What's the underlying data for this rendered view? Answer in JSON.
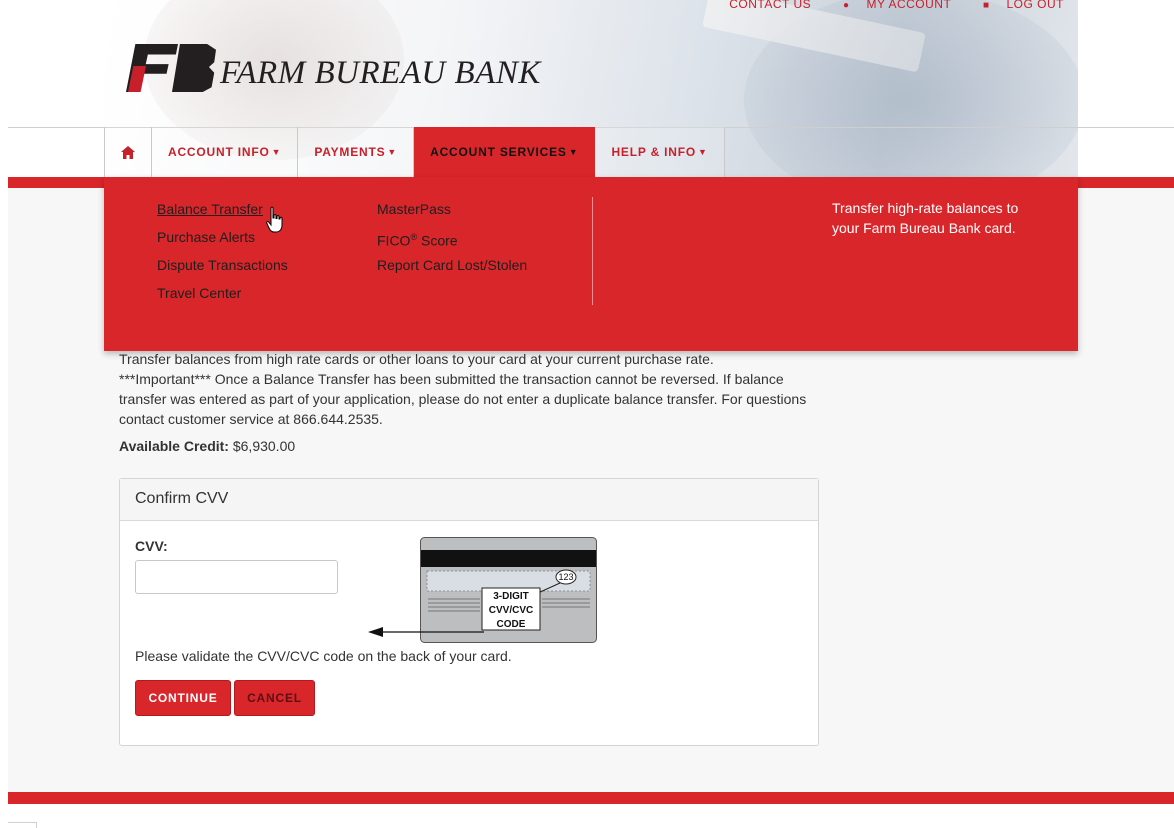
{
  "top_links": {
    "contact": "CONTACT US",
    "my_account": "MY ACCOUNT",
    "log_out": "LOG OUT"
  },
  "brand": {
    "name": "FARM BUREAU",
    "name_suffix": "BANK",
    "primary_color": "#d9262b"
  },
  "nav": {
    "items": [
      {
        "label": "ACCOUNT INFO"
      },
      {
        "label": "PAYMENTS"
      },
      {
        "label": "ACCOUNT SERVICES"
      },
      {
        "label": "HELP & INFO"
      }
    ],
    "active": "ACCOUNT SERVICES"
  },
  "dropdown": {
    "col1": [
      "Balance Transfer",
      "Purchase Alerts",
      "Dispute Transactions",
      "Travel Center"
    ],
    "col2": {
      "masterpass": "MasterPass",
      "fico_pre": "FICO",
      "fico_sup": "®",
      "fico_post": " Score",
      "lost_stolen": "Report Card Lost/Stolen"
    },
    "description": "Transfer high-rate balances to your Farm Bureau Bank card."
  },
  "intro": {
    "line1": "Transfer balances from high rate cards or other loans to your card at your current purchase rate.",
    "line2": "***Important*** Once a Balance Transfer has been submitted the transaction cannot be reversed. If balance transfer was entered as part of your application, please do not enter a duplicate balance transfer. For questions contact customer service at 866.644.2535."
  },
  "credit": {
    "label": "Available Credit:",
    "value": "$6,930.00"
  },
  "cvv_panel": {
    "title": "Confirm CVV",
    "field_label": "CVV:",
    "field_value": "",
    "card_code": "123",
    "card_caption_1": "3-DIGIT",
    "card_caption_2": "CVV/CVC",
    "card_caption_3": "CODE",
    "instruction": "Please validate the CVV/CVC code on the back of your card.",
    "continue_label": "CONTINUE",
    "cancel_label": "CANCEL"
  }
}
